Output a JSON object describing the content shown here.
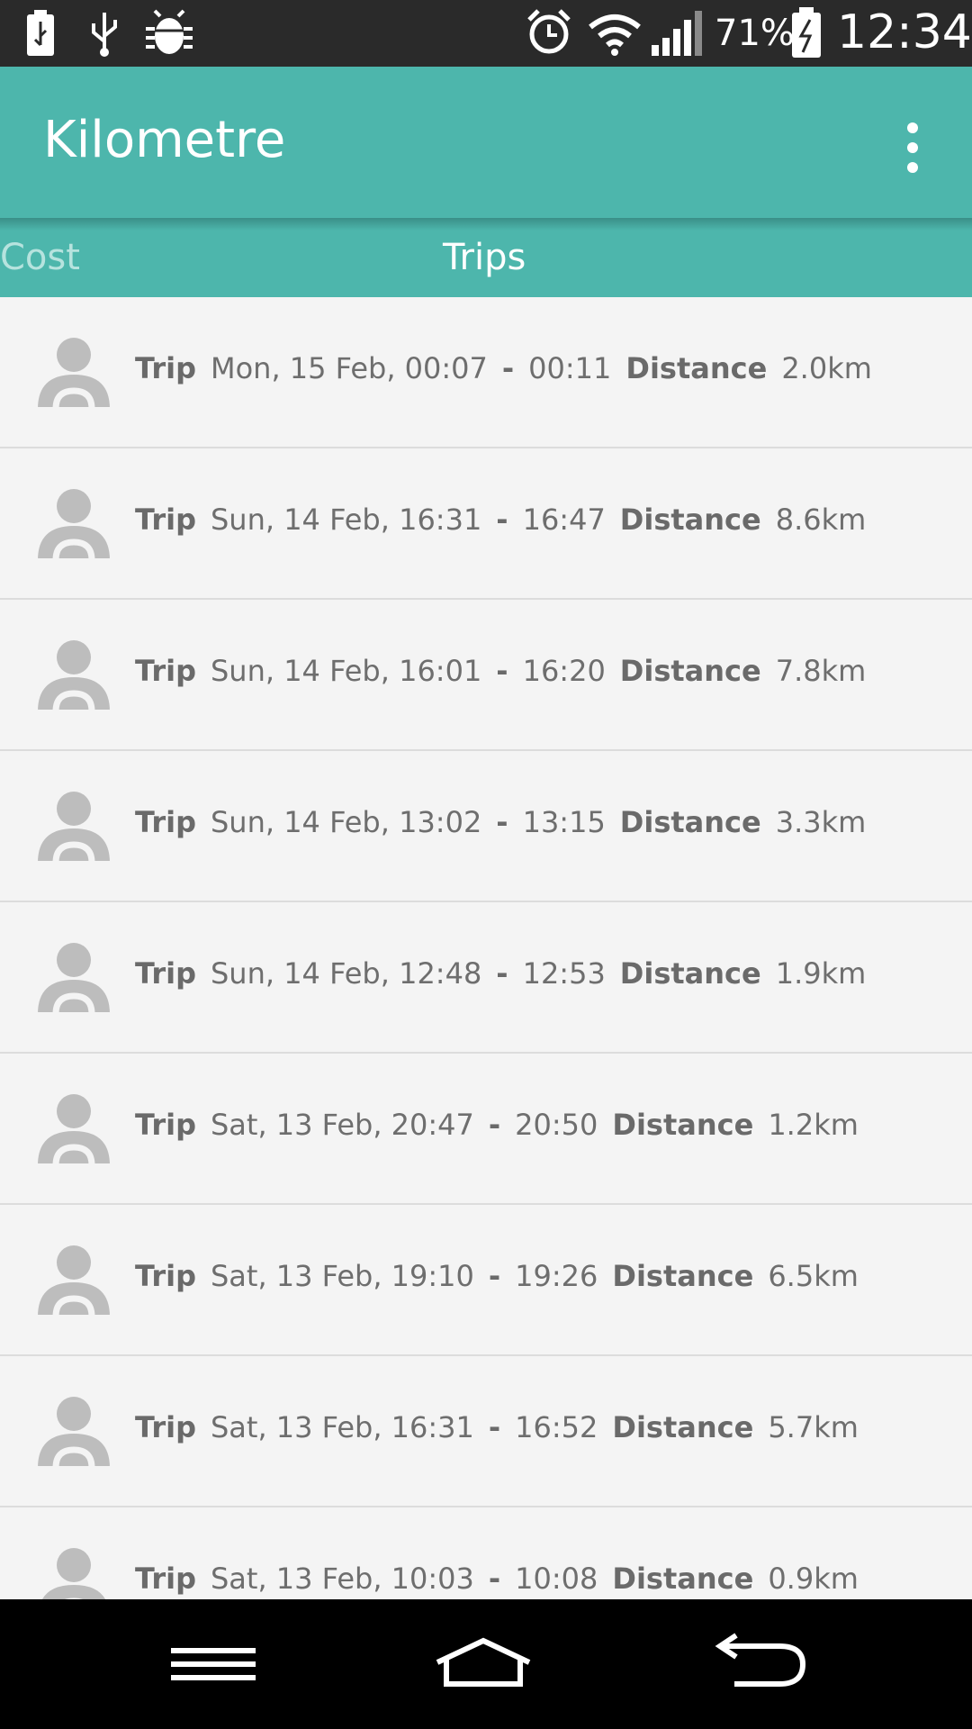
{
  "status_bar": {
    "battery_percent": "71%",
    "time": "12:34",
    "icons": [
      "usb-battery-icon",
      "usb-icon",
      "debug-icon",
      "alarm-icon",
      "wifi-icon",
      "signal-icon",
      "battery-charging-icon"
    ]
  },
  "app_bar": {
    "title": "Kilometre",
    "overflow_icon": "more-vert-icon"
  },
  "tabs": [
    {
      "label": "Cost"
    },
    {
      "label": "Trips"
    }
  ],
  "trips": [
    {
      "label": "Trip",
      "start": "Mon, 15 Feb, 00:07",
      "sep": "-",
      "end": "00:11",
      "distance_label": "Distance",
      "distance": "2.0km"
    },
    {
      "label": "Trip",
      "start": "Sun, 14 Feb, 16:31",
      "sep": "-",
      "end": "16:47",
      "distance_label": "Distance",
      "distance": "8.6km"
    },
    {
      "label": "Trip",
      "start": "Sun, 14 Feb, 16:01",
      "sep": "-",
      "end": "16:20",
      "distance_label": "Distance",
      "distance": "7.8km"
    },
    {
      "label": "Trip",
      "start": "Sun, 14 Feb, 13:02",
      "sep": "-",
      "end": "13:15",
      "distance_label": "Distance",
      "distance": "3.3km"
    },
    {
      "label": "Trip",
      "start": "Sun, 14 Feb, 12:48",
      "sep": "-",
      "end": "12:53",
      "distance_label": "Distance",
      "distance": "1.9km"
    },
    {
      "label": "Trip",
      "start": "Sat, 13 Feb, 20:47",
      "sep": "-",
      "end": "20:50",
      "distance_label": "Distance",
      "distance": "1.2km"
    },
    {
      "label": "Trip",
      "start": "Sat, 13 Feb, 19:10",
      "sep": "-",
      "end": "19:26",
      "distance_label": "Distance",
      "distance": "6.5km"
    },
    {
      "label": "Trip",
      "start": "Sat, 13 Feb, 16:31",
      "sep": "-",
      "end": "16:52",
      "distance_label": "Distance",
      "distance": "5.7km"
    },
    {
      "label": "Trip",
      "start": "Sat, 13 Feb, 10:03",
      "sep": "-",
      "end": "10:08",
      "distance_label": "Distance",
      "distance": "0.9km"
    }
  ],
  "nav_bar": {
    "icons": [
      "menu-icon",
      "home-icon",
      "back-icon"
    ]
  },
  "colors": {
    "accent": "#4db6ac",
    "list_background": "#f4f4f4",
    "text": "#6e6e6e",
    "avatar": "#bdbdbd"
  }
}
